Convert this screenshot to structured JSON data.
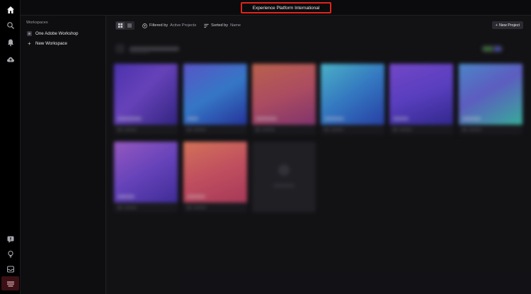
{
  "topbar": {
    "title": "Experience Platform International",
    "highlight_color": "#e0241b"
  },
  "rail": {
    "icons": [
      "home-icon",
      "search-icon",
      "bell-icon",
      "cloud-upload-icon",
      "feedback-icon",
      "lightbulb-icon",
      "inbox-icon",
      "account-badge-icon"
    ]
  },
  "workspaces": {
    "header": "Workspaces",
    "items": [
      {
        "label": "One Adobe Workshop",
        "icon": "workspace-icon"
      },
      {
        "label": "New Workspace",
        "icon": "plus-icon"
      }
    ]
  },
  "toolbar": {
    "filter_key": "Filtered by",
    "filter_value": "Active Projects",
    "sort_key": "Sorted by",
    "sort_value": "Name",
    "new_project_label": "New Project"
  },
  "colors": {
    "background": "#000000",
    "main_bg": "#141418",
    "sidebar_bg": "#0e0e10"
  }
}
